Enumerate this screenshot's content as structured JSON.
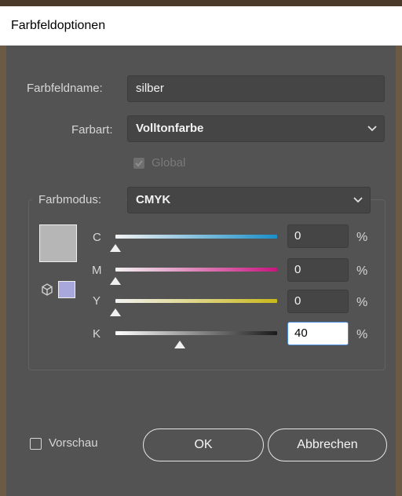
{
  "window": {
    "title": "Farbfeldoptionen"
  },
  "swatch_name": {
    "label": "Farbfeldname:",
    "value": "silber"
  },
  "color_type": {
    "label": "Farbart:",
    "value": "Volltonfarbe"
  },
  "global": {
    "label": "Global",
    "checked": true,
    "disabled": true
  },
  "color_mode": {
    "label": "Farbmodus:",
    "value": "CMYK"
  },
  "channels": [
    {
      "label": "C",
      "value": "0",
      "unit": "%",
      "level": 0
    },
    {
      "label": "M",
      "value": "0",
      "unit": "%",
      "level": 0
    },
    {
      "label": "Y",
      "value": "0",
      "unit": "%",
      "level": 0
    },
    {
      "label": "K",
      "value": "40",
      "unit": "%",
      "level": 40
    }
  ],
  "preview": {
    "label": "Vorschau",
    "checked": false
  },
  "buttons": {
    "ok": "OK",
    "cancel": "Abbrechen"
  },
  "colors": {
    "swatch_main": "#b6b6b6",
    "swatch_spot": "#a8a8dc",
    "cyan": "#1a8fc9",
    "magenta": "#c8167f",
    "yellow": "#c9b81a"
  }
}
